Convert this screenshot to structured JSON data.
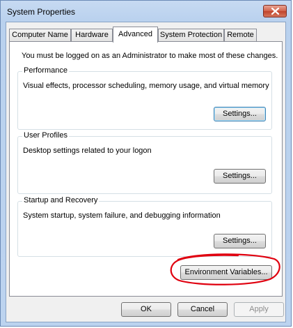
{
  "window": {
    "title": "System Properties"
  },
  "tabs": [
    {
      "label": "Computer Name",
      "active": false
    },
    {
      "label": "Hardware",
      "active": false
    },
    {
      "label": "Advanced",
      "active": true
    },
    {
      "label": "System Protection",
      "active": false
    },
    {
      "label": "Remote",
      "active": false
    }
  ],
  "notice": "You must be logged on as an Administrator to make most of these changes.",
  "performance": {
    "title": "Performance",
    "description": "Visual effects, processor scheduling, memory usage, and virtual memory",
    "button": "Settings..."
  },
  "user_profiles": {
    "title": "User Profiles",
    "description": "Desktop settings related to your logon",
    "button": "Settings..."
  },
  "startup_recovery": {
    "title": "Startup and Recovery",
    "description": "System startup, system failure, and debugging information",
    "button": "Settings..."
  },
  "environment_variables_button": "Environment Variables...",
  "footer": {
    "ok": "OK",
    "cancel": "Cancel",
    "apply": "Apply"
  },
  "colors": {
    "annotation_circle": "#e0000f",
    "close_button": "#c7503a"
  },
  "icons": {
    "close": "close-icon"
  }
}
